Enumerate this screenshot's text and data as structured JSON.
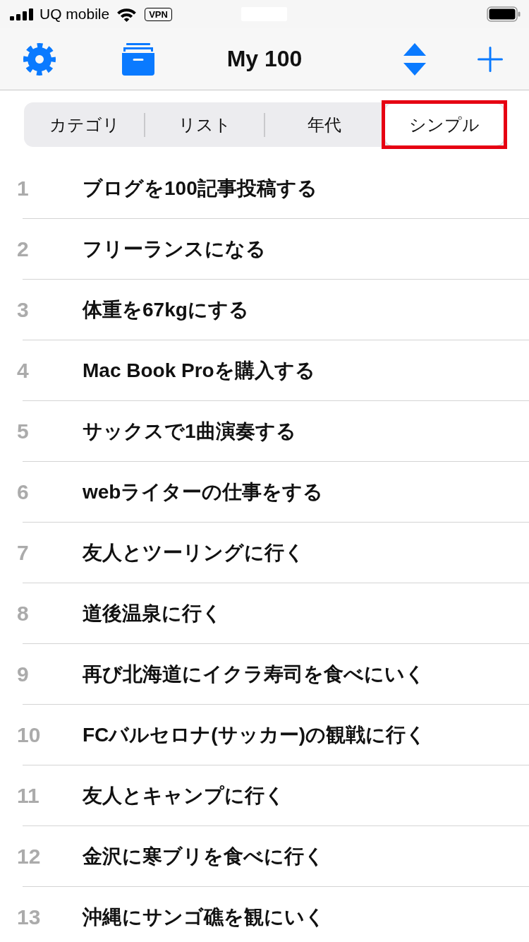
{
  "status_bar": {
    "carrier": "UQ mobile",
    "vpn_label": "VPN"
  },
  "nav_bar": {
    "title": "My 100"
  },
  "segments": [
    {
      "label": "カテゴリ",
      "selected": false,
      "highlighted": false
    },
    {
      "label": "リスト",
      "selected": false,
      "highlighted": false
    },
    {
      "label": "年代",
      "selected": false,
      "highlighted": false
    },
    {
      "label": "シンプル",
      "selected": true,
      "highlighted": true
    }
  ],
  "items": [
    {
      "number": "1",
      "title": "ブログを100記事投稿する"
    },
    {
      "number": "2",
      "title": "フリーランスになる"
    },
    {
      "number": "3",
      "title": "体重を67kgにする"
    },
    {
      "number": "4",
      "title": "Mac Book Proを購入する"
    },
    {
      "number": "5",
      "title": "サックスで1曲演奏する"
    },
    {
      "number": "6",
      "title": "webライターの仕事をする"
    },
    {
      "number": "7",
      "title": "友人とツーリングに行く"
    },
    {
      "number": "8",
      "title": "道後温泉に行く"
    },
    {
      "number": "9",
      "title": "再び北海道にイクラ寿司を食べにいく"
    },
    {
      "number": "10",
      "title": "FCバルセロナ(サッカー)の観戦に行く"
    },
    {
      "number": "11",
      "title": "友人とキャンプに行く"
    },
    {
      "number": "12",
      "title": "金沢に寒ブリを食べに行く"
    },
    {
      "number": "13",
      "title": "沖縄にサンゴ礁を観にいく"
    }
  ]
}
